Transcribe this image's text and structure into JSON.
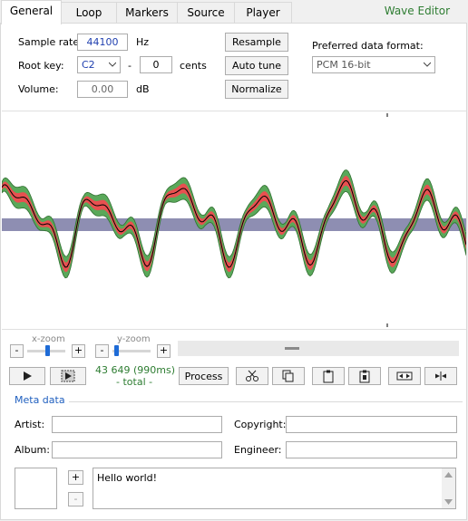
{
  "tabs": [
    {
      "label": "General",
      "active": true
    },
    {
      "label": "Loop",
      "active": false
    },
    {
      "label": "Markers",
      "active": false
    },
    {
      "label": "Source",
      "active": false
    },
    {
      "label": "Player",
      "active": false
    }
  ],
  "window_title": "Wave Editor",
  "general": {
    "sample_rate_label": "Sample rate:",
    "sample_rate_value": "44100",
    "sample_rate_unit": "Hz",
    "root_key_label": "Root key:",
    "root_key_value": "C2",
    "dash": "-",
    "cents_value": "0",
    "cents_unit": "cents",
    "volume_label": "Volume:",
    "volume_value": "0.00",
    "volume_unit": "dB",
    "resample_label": "Resample",
    "autotune_label": "Auto tune",
    "normalize_label": "Normalize",
    "format_label": "Preferred data format:",
    "format_value": "PCM 16-bit"
  },
  "zoom": {
    "x_label": "x-zoom",
    "y_label": "y-zoom",
    "minus": "-",
    "plus": "+",
    "x_level": 0.55,
    "y_level": 0.05
  },
  "sample_info": {
    "count": "43 649 (990ms)",
    "sub": "- total -"
  },
  "tools": {
    "process_label": "Process"
  },
  "meta": {
    "title": "Meta data",
    "artist_label": "Artist:",
    "copyright_label": "Copyright:",
    "album_label": "Album:",
    "engineer_label": "Engineer:",
    "artist_value": "",
    "copyright_value": "",
    "album_value": "",
    "engineer_value": "",
    "comment": "Hello world!",
    "add": "+",
    "remove": "-"
  },
  "colors": {
    "accent_text": "#2e7d32",
    "wave_green": "#5aa85a",
    "wave_red": "#e85050",
    "wave_band": "#8e8eb2",
    "meta_title": "#1f5fbf"
  }
}
